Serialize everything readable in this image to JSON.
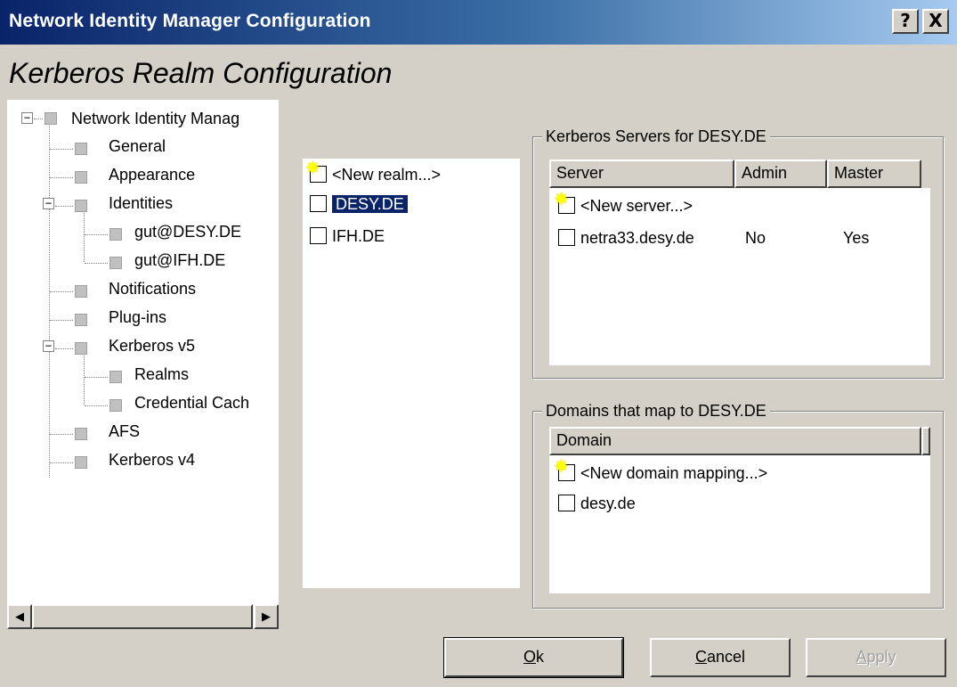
{
  "window": {
    "title": "Network Identity Manager Configuration",
    "help_label": "?",
    "close_label": "X"
  },
  "page": {
    "title": "Kerberos Realm Configuration"
  },
  "tree": {
    "items": [
      {
        "label": "Network Identity Manag",
        "expanded": true
      },
      {
        "label": "General"
      },
      {
        "label": "Appearance"
      },
      {
        "label": "Identities",
        "expanded": true
      },
      {
        "label": "gut@DESY.DE"
      },
      {
        "label": "gut@IFH.DE"
      },
      {
        "label": "Notifications"
      },
      {
        "label": "Plug-ins"
      },
      {
        "label": "Kerberos v5",
        "expanded": true
      },
      {
        "label": "Realms"
      },
      {
        "label": "Credential Cach"
      },
      {
        "label": "AFS"
      },
      {
        "label": "Kerberos v4"
      }
    ],
    "expand_glyph": "−",
    "scroll_left": "◀",
    "scroll_right": "▶"
  },
  "realms": {
    "items": [
      {
        "label": "<New realm...>",
        "new": true
      },
      {
        "label": "DESY.DE",
        "selected": true
      },
      {
        "label": "IFH.DE"
      }
    ]
  },
  "servers": {
    "group_label": "Kerberos Servers for DESY.DE",
    "columns": [
      "Server",
      "Admin",
      "Master"
    ],
    "rows": [
      {
        "server": "<New server...>",
        "admin": "",
        "master": "",
        "new": true
      },
      {
        "server": "netra33.desy.de",
        "admin": "No",
        "master": "Yes"
      }
    ]
  },
  "domains": {
    "group_label": "Domains that map to DESY.DE",
    "columns": [
      "Domain"
    ],
    "rows": [
      {
        "domain": "<New domain mapping...>",
        "new": true
      },
      {
        "domain": "desy.de"
      }
    ]
  },
  "buttons": {
    "ok": "Ok",
    "ok_accel": "O",
    "ok_rest": "k",
    "cancel_accel": "C",
    "cancel_rest": "ancel",
    "apply_accel": "A",
    "apply_rest": "pply"
  },
  "icons": {
    "new_marker": "star-icon",
    "checkbox": "checkbox-icon",
    "tree_node": "tree-node-icon"
  },
  "colors": {
    "selection": "#0a246a",
    "titlebar_start": "#0a246a",
    "titlebar_end": "#a6caf0",
    "star": "#ffff00"
  }
}
